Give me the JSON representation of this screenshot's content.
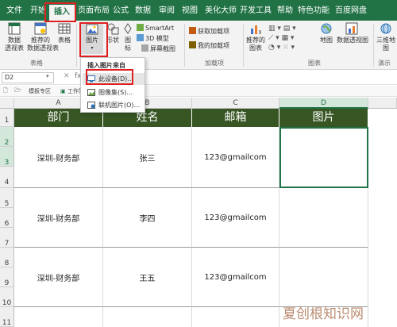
{
  "tabs": [
    "文件",
    "开始",
    "插入",
    "页面布局",
    "公式",
    "数据",
    "审阅",
    "视图",
    "美化大师",
    "开发工具",
    "帮助",
    "特色功能",
    "百度网盘"
  ],
  "ribbon": {
    "pivot": "数据\n透视表",
    "rec_pivot": "推荐的\n数据透视表",
    "table": "表格",
    "picture": "图片",
    "shape": "形状",
    "icon": "图\n标",
    "smartart": "SmartArt",
    "model3d": "3D 模型",
    "screenshot": "屏幕截图",
    "get_addins": "获取加载项",
    "my_addins": "我的加载项",
    "rec_charts": "推荐的\n图表",
    "maps": "地图",
    "pivot_chart": "数据透视图",
    "three_d": "三维地\n图",
    "group_tables": "表格",
    "group_addins": "加载项",
    "group_charts": "图表",
    "group_demo": "演示"
  },
  "namebox": "D2",
  "fx": "fx",
  "sheet_strip": [
    "模板专区",
    "工作簿"
  ],
  "dropdown": {
    "title": "插入图片来自",
    "items": [
      "此设备(D)...",
      "图像集(S)...",
      "联机图片(O)..."
    ]
  },
  "columns": [
    "A",
    "B",
    "C",
    "D"
  ],
  "rows": [
    "1",
    "2",
    "3",
    "4",
    "5",
    "6",
    "7",
    "8",
    "9",
    "10",
    "11"
  ],
  "headers": [
    "部门",
    "姓名",
    "邮箱",
    "图片"
  ],
  "records": [
    {
      "dept": "深圳-财务部",
      "name": "张三",
      "email": "123@gmailcom"
    },
    {
      "dept": "深圳-财务部",
      "name": "李四",
      "email": "123@gmailcom"
    },
    {
      "dept": "深圳-财务部",
      "name": "王五",
      "email": "123@gmailcom"
    }
  ],
  "watermark": "夏创根知识网",
  "colors": {
    "accent": "#217346",
    "header_fill": "#375623",
    "highlight": "#e02020"
  }
}
